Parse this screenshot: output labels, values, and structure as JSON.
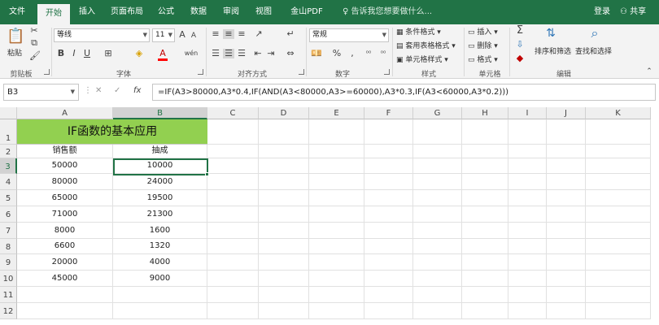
{
  "menu": {
    "tabs": [
      "文件",
      "开始",
      "插入",
      "页面布局",
      "公式",
      "数据",
      "审阅",
      "视图",
      "金山PDF"
    ],
    "active": "开始",
    "help": "告诉我您想要做什么...",
    "login": "登录",
    "share": "共享"
  },
  "ribbon": {
    "clipboard": {
      "label": "剪贴板",
      "paste": "粘贴"
    },
    "font": {
      "label": "字体",
      "name": "等线",
      "size": "11",
      "bold": "B",
      "italic": "I",
      "underline": "U",
      "grow": "A",
      "shrink": "A",
      "wen": "wén"
    },
    "alignment": {
      "label": "对齐方式"
    },
    "number": {
      "label": "数字",
      "format": "常规",
      "percent": "%"
    },
    "styles": {
      "label": "样式",
      "conditional": "条件格式",
      "table": "套用表格格式",
      "cell_style": "单元格样式"
    },
    "cells": {
      "label": "单元格",
      "insert": "插入",
      "delete": "删除",
      "format": "格式"
    },
    "editing": {
      "label": "编辑",
      "sort": "排序和筛选",
      "find": "查找和选择"
    }
  },
  "formula_bar": {
    "name_box": "B3",
    "fx": "fx",
    "formula": "=IF(A3>80000,A3*0.4,IF(AND(A3<80000,A3>=60000),A3*0.3,IF(A3<60000,A3*0.2)))"
  },
  "sheet": {
    "columns": [
      "A",
      "B",
      "C",
      "D",
      "E",
      "F",
      "G",
      "H",
      "I",
      "J",
      "K"
    ],
    "rows": [
      "1",
      "2",
      "3",
      "4",
      "5",
      "6",
      "7",
      "8",
      "9",
      "10",
      "11",
      "12"
    ],
    "title": "IF函数的基本应用",
    "headers": [
      "销售额",
      "抽成"
    ],
    "data": [
      [
        "50000",
        "10000"
      ],
      [
        "80000",
        "24000"
      ],
      [
        "65000",
        "19500"
      ],
      [
        "71000",
        "21300"
      ],
      [
        "8000",
        "1600"
      ],
      [
        "6600",
        "1320"
      ],
      [
        "20000",
        "4000"
      ],
      [
        "45000",
        "9000"
      ]
    ],
    "selected": "B3",
    "colors": {
      "title_fill": "#92d050",
      "accent": "#217346"
    }
  }
}
